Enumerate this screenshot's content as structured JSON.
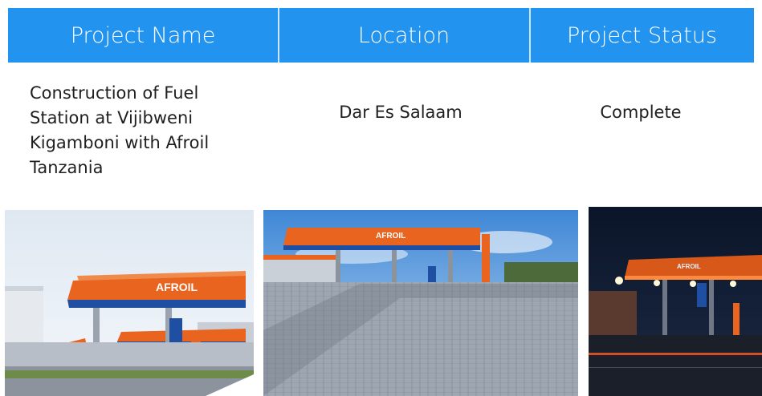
{
  "table": {
    "headers": [
      "Project Name",
      "Location",
      "Project Status"
    ],
    "rows": [
      {
        "name": "Construction of Fuel Station at Vijibweni Kigamboni with Afroil Tanzania",
        "location": "Dar Es Salaam",
        "status": "Complete"
      }
    ]
  },
  "photos": [
    {
      "brand_text": "AFROIL",
      "scene": "day-render"
    },
    {
      "brand_text": "AFROIL",
      "scene": "day-photo"
    },
    {
      "brand_text": "AFROIL",
      "scene": "night-photo"
    }
  ],
  "colors": {
    "header_bg": "#2293ee",
    "header_text": "#ffffff",
    "canopy_orange": "#e8641f",
    "brand_blue": "#1f4fa3"
  }
}
